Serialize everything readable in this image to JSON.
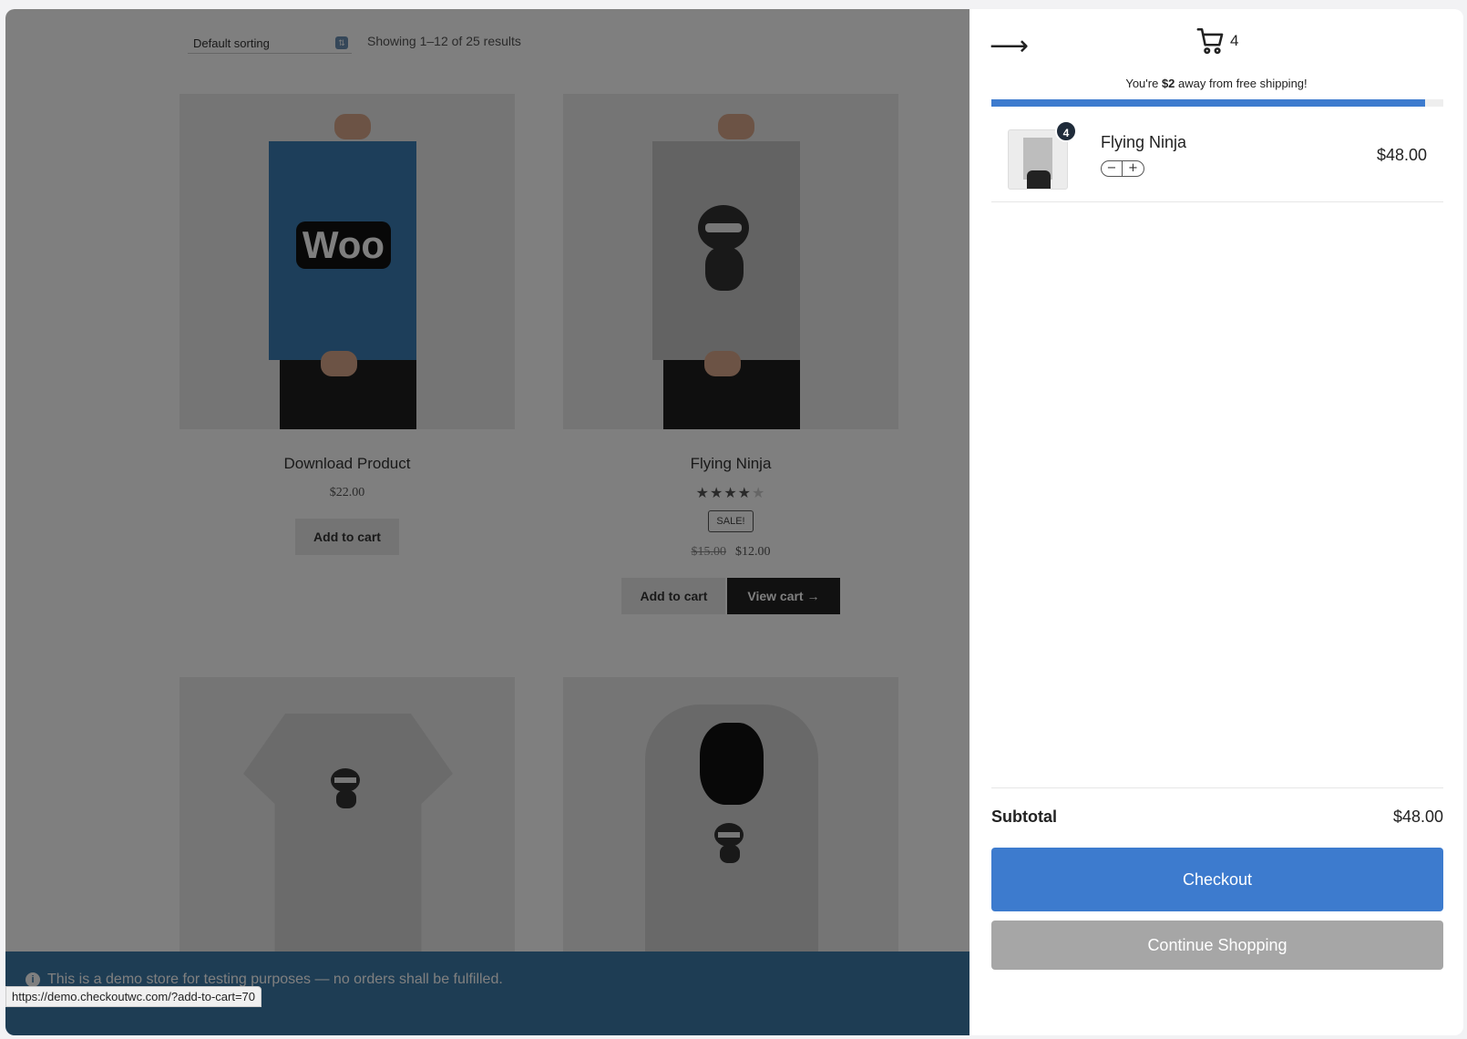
{
  "store": {
    "sort_label": "Default sorting",
    "results_count": "Showing 1–12 of 25 results",
    "products": [
      {
        "title": "Download Product",
        "price": "$22.00",
        "button": "Add to cart",
        "poster_text": "Woo"
      },
      {
        "title": "Flying Ninja",
        "rating": 4,
        "rating_max": 5,
        "badge": "SALE!",
        "old_price": "$15.00",
        "price": "$12.00",
        "button": "Add to cart",
        "view_cart": "View cart"
      }
    ],
    "demo_notice": "This is a demo store for testing purposes — no orders shall be fulfilled.",
    "status_url": "https://demo.checkoutwc.com/?add-to-cart=70"
  },
  "cart": {
    "count": "4",
    "shipping_prefix": "You're ",
    "shipping_amount": "$2",
    "shipping_suffix": " away from free shipping!",
    "shipping_progress": 0.96,
    "items": [
      {
        "name": "Flying Ninja",
        "quantity": "4",
        "price": "$48.00"
      }
    ],
    "subtotal_label": "Subtotal",
    "subtotal_value": "$48.00",
    "checkout_label": "Checkout",
    "continue_label": "Continue Shopping"
  },
  "colors": {
    "accent": "#3d7bce",
    "demo_bar": "#3d7aa8",
    "continue_bg": "#a6a6a6"
  },
  "icons": [
    "close-arrow-icon",
    "cart-icon",
    "info-icon",
    "minus-icon",
    "plus-icon",
    "sort-arrow-icon"
  ]
}
